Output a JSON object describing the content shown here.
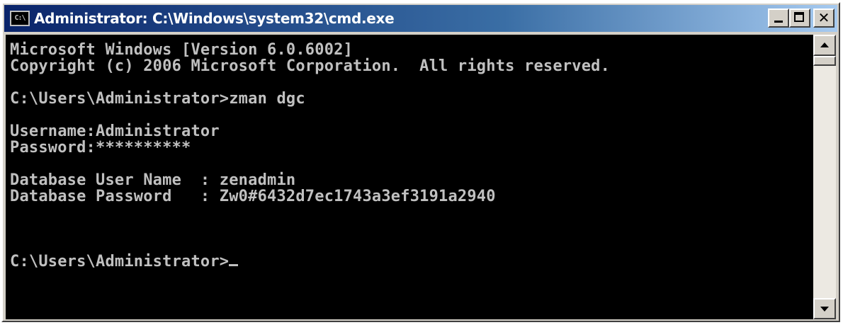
{
  "window": {
    "title": "Administrator: C:\\Windows\\system32\\cmd.exe",
    "icon_text": "C:\\",
    "icon": "cmd-icon"
  },
  "title_buttons": {
    "minimize_icon": "minimize-icon",
    "maximize_icon": "maximize-icon",
    "close_icon": "close-icon",
    "close_label": "✕"
  },
  "console": {
    "lines": [
      "Microsoft Windows [Version 6.0.6002]",
      "Copyright (c) 2006 Microsoft Corporation.  All rights reserved.",
      "",
      "C:\\Users\\Administrator>zman dgc",
      "",
      "Username:Administrator",
      "Password:**********",
      "",
      "Database User Name  : zenadmin",
      "Database Password   : Zw0#6432d7ec1743a3ef3191a2940",
      "",
      "",
      "",
      "C:\\Users\\Administrator>"
    ],
    "colors": {
      "background": "#000000",
      "foreground": "#c0c0c0"
    }
  },
  "scrollbar": {
    "up_icon": "scroll-up-arrow-icon",
    "down_icon": "scroll-down-arrow-icon"
  }
}
